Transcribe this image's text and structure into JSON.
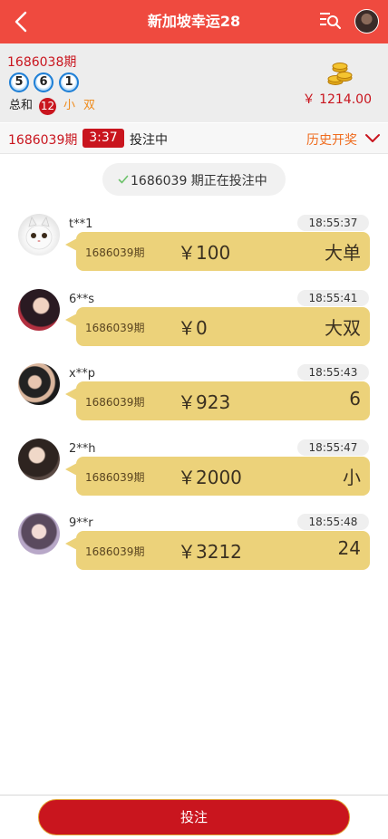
{
  "header": {
    "title": "新加坡幸运28",
    "back_icon": "chevron-left-icon",
    "menu_icon": "list-search-icon",
    "avatar_icon": "user-avatar"
  },
  "last_draw": {
    "period": "1686038期",
    "balls": [
      "5",
      "6",
      "1"
    ],
    "sum_label": "总和",
    "sum_value": "12",
    "size": "小",
    "parity": "双",
    "balance": "￥ 1214.00",
    "coins_icon": "coin-stack-icon"
  },
  "current": {
    "period": "1686039期",
    "countdown": "3:37",
    "status": "投注中",
    "history_label": "历史开奖",
    "history_icon": "chevron-down-icon"
  },
  "notice": {
    "text": "1686039 期正在投注中",
    "icon": "check-icon"
  },
  "bets": [
    {
      "user": "t**1",
      "time": "18:55:37",
      "period": "1686039期",
      "amount": "￥100",
      "choice": "大单"
    },
    {
      "user": "6**s",
      "time": "18:55:41",
      "period": "1686039期",
      "amount": "￥0",
      "choice": "大双"
    },
    {
      "user": "x**p",
      "time": "18:55:43",
      "period": "1686039期",
      "amount": "￥923",
      "choice": "6"
    },
    {
      "user": "2**h",
      "time": "18:55:47",
      "period": "1686039期",
      "amount": "￥2000",
      "choice": "小"
    },
    {
      "user": "9**r",
      "time": "18:55:48",
      "period": "1686039期",
      "amount": "￥3212",
      "choice": "24"
    }
  ],
  "footer": {
    "bet_button": "投注"
  },
  "colors": {
    "header": "#ef4a3f",
    "accent_red": "#c9151e",
    "accent_orange": "#ef6b1e",
    "bubble": "#ecd27a"
  }
}
